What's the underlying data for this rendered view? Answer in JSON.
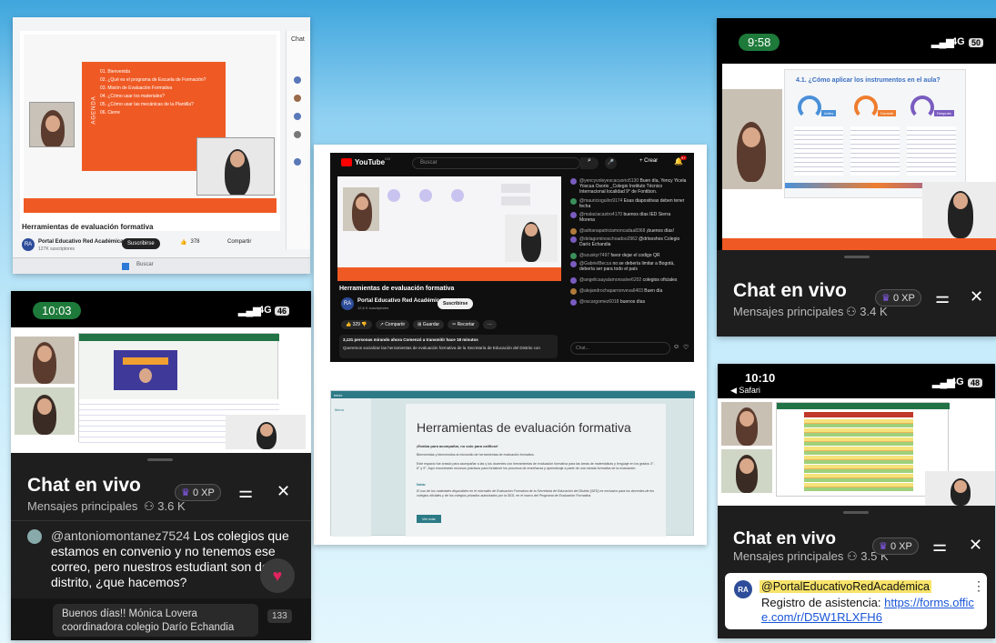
{
  "tile1": {
    "video_title": "Herramientas de evaluación formativa",
    "channel_name": "Portal Educativo Red Académica",
    "channel_subs": "127K suscriptores",
    "subscribe_label": "Suscribirse",
    "likes": "378",
    "share_label": "Compartir",
    "agenda_label": "AGENDA",
    "chat_partial": "Chat",
    "search_label": "Buscar",
    "agenda_items": [
      "01. Bienvenida",
      "02. ¿Qué es el programa de Escuela de Formación?",
      "03. Misión de Evaluación Formativa",
      "04. ¿Cómo usar los materiales?",
      "05. ¿Cómo usar las mecánicas de la Plantilla?",
      "06. Cierre"
    ]
  },
  "tile2": {
    "time": "9:58",
    "network": "4G",
    "battery": "50",
    "slide_title": "4.1. ¿Cómo aplicar los instrumentos en el aula?",
    "phases": [
      "Antes",
      "Durante",
      "Después"
    ],
    "chat_title": "Chat en vivo",
    "chat_sub": "Mensajes principales",
    "viewers": "3.4 K",
    "xp": "0 XP"
  },
  "tile3": {
    "time": "10:03",
    "network": "4G",
    "battery": "46",
    "chat_title": "Chat en vivo",
    "chat_sub": "Mensajes principales",
    "viewers": "3.6 K",
    "xp": "0 XP",
    "message_user": "@antoniomontanez7524",
    "message_text": "Los colegios que estamos en convenio y no tenemos ese correo, pero nuestros estudiant son del distrito, ¿que hacemos?",
    "reply_text": "Buenos días!! Mónica Lovera coordinadora colegio Darío Echandia",
    "reply_count": "133"
  },
  "tile4": {
    "yt_brand": "YouTube",
    "yt_region": "CO",
    "search_placeholder": "Buscar",
    "create_label": "Crear",
    "notif_count": "9+",
    "video_title": "Herramientas de evaluación formativa",
    "channel_name": "Portal Educativo Red Académica",
    "channel_subs": "12,6 K suscriptores",
    "subscribe_label": "Suscribirse",
    "likes": "329",
    "share_label": "Compartir",
    "save_label": "Guardar",
    "clip_label": "Recortar",
    "watching": "3,131 personas mirando ahora  Comenzó a transmitir hace 18 minutos",
    "description": "Queremos socializar las herramientas de evaluación formativa de la Secretaría de Educación del Distrito con",
    "chat_placeholder": "Chat...",
    "comments": [
      {
        "user": "@yencyvoleyescacuorio5130",
        "text": "Buen día, Yency Yicela Yoscua Osorio _Colegio Instituto Técnico Internacional localidad 9° de Fontibon."
      },
      {
        "user": "@mauricioguilro9174",
        "text": "Esas diapositivas deben tener fecha"
      },
      {
        "user": "@malaciacastro4170",
        "text": "buenos días IED Sierra Morena"
      },
      {
        "user": "@adrianapatriciamoncadaa8368",
        "text": "¡buenos días!"
      },
      {
        "user": "@delagominoschoadoo2962",
        "text": "@drlooshos Colegio Darío Echandia"
      },
      {
        "user": "@szuskyr7497",
        "text": "favor dejar el codigo QR"
      },
      {
        "user": "@GabrielBecca",
        "text": "no se debería limitar a Bogotá, debería ser para todo el país"
      },
      {
        "user": "@angelicaayalamonsalve6202",
        "text": "colegios oficiales"
      },
      {
        "user": "@alejandrochaparronveva6403",
        "text": "Buen día"
      },
      {
        "user": "@oscargomez6018",
        "text": "buenos días"
      }
    ],
    "site_heading": "Herramientas de evaluación formativa",
    "site_sub": "¡Evalúa para acompañar, no solo para calificar!",
    "site_p1": "Bienvenidas y bienvenidos al micrositio de herramientas de evaluación formativa.",
    "site_p2": "Este espacio fue creado para acompañar a las y los docentes con herramientas de evaluación formativa para las áreas de matemáticas y lenguaje en los grados 3°, 6° y 9°. Aquí encontrarán recursos prácticos para fortalecer los procesos de enseñanza y aprendizaje a partir de una mirada formativa de la evaluación.",
    "site_note_label": "Nota:",
    "site_note": "El uso de los materiales disponibles en el micrositio de Evaluación Formativa de la Secretaría de Educación del Distrito (SED) es exclusivo para los docentes de los colegios oficiales y de los colegios privados autorizados por la SED, en el marco del Programa de Evaluación Formativa.",
    "site_button": "Ver más",
    "site_nav": [
      "Inicio",
      "Menú"
    ]
  },
  "tile5": {
    "time": "10:10",
    "back_label": "◀ Safari",
    "network": "4G",
    "battery": "48",
    "chat_title": "Chat en vivo",
    "chat_sub": "Mensajes principales",
    "viewers": "3.5 K",
    "xp": "0 XP",
    "pinned_avatar": "RA",
    "pinned_user": "@PortalEducativoRedAcadémica",
    "pinned_text": "Registro de asistencia: ",
    "pinned_link": "https://forms.office.com/r/D5W1RLXFH6"
  },
  "colors": {
    "accent_orange": "#ef5a24",
    "youtube_red": "#ff0000",
    "chat_bg": "#1e1e1e",
    "time_green": "#1e7a3a",
    "link_blue": "#1a56d8",
    "highlight_yellow": "#f7e36a"
  }
}
